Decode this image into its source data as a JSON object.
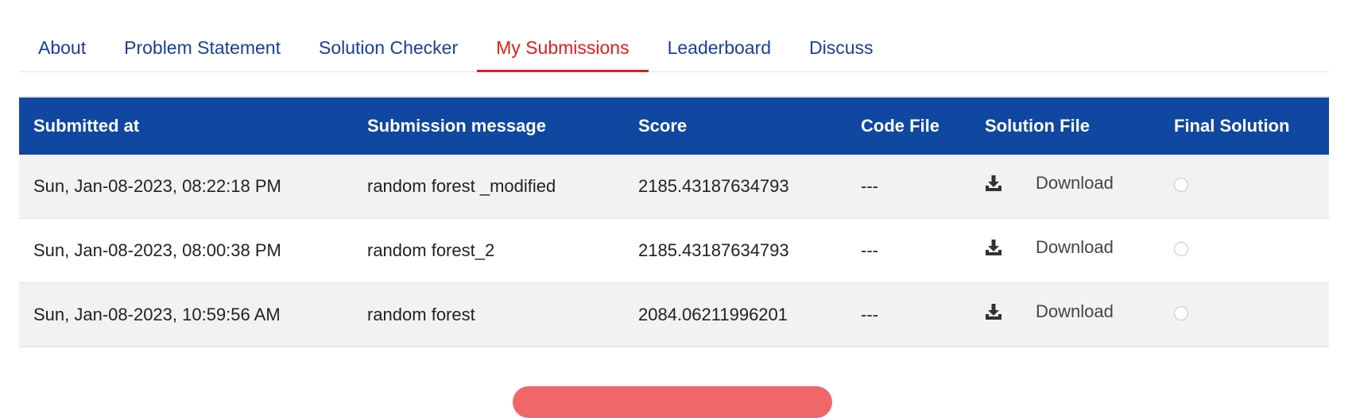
{
  "tabs": [
    {
      "label": "About"
    },
    {
      "label": "Problem Statement"
    },
    {
      "label": "Solution Checker"
    },
    {
      "label": "My Submissions",
      "active": true
    },
    {
      "label": "Leaderboard"
    },
    {
      "label": "Discuss"
    }
  ],
  "table": {
    "headers": [
      "Submitted at",
      "Submission message",
      "Score",
      "Code File",
      "Solution File",
      "Final Solution"
    ],
    "rows": [
      {
        "submitted_at": "Sun, Jan-08-2023, 08:22:18 PM",
        "message": "random forest _modified",
        "score": "2185.43187634793",
        "code_file": "---",
        "solution_file": "Download",
        "final_selected": false
      },
      {
        "submitted_at": "Sun, Jan-08-2023, 08:00:38 PM",
        "message": "random forest_2",
        "score": "2185.43187634793",
        "code_file": "---",
        "solution_file": "Download",
        "final_selected": false
      },
      {
        "submitted_at": "Sun, Jan-08-2023, 10:59:56 AM",
        "message": "random forest",
        "score": "2084.06211996201",
        "code_file": "---",
        "solution_file": "Download",
        "final_selected": false
      }
    ]
  },
  "icons": {
    "download": "download-tray-icon"
  },
  "colors": {
    "header_bg": "#0f47a1",
    "tab_text": "#1a3f96",
    "active_tab": "#e11d1d",
    "button": "#f0676a"
  }
}
